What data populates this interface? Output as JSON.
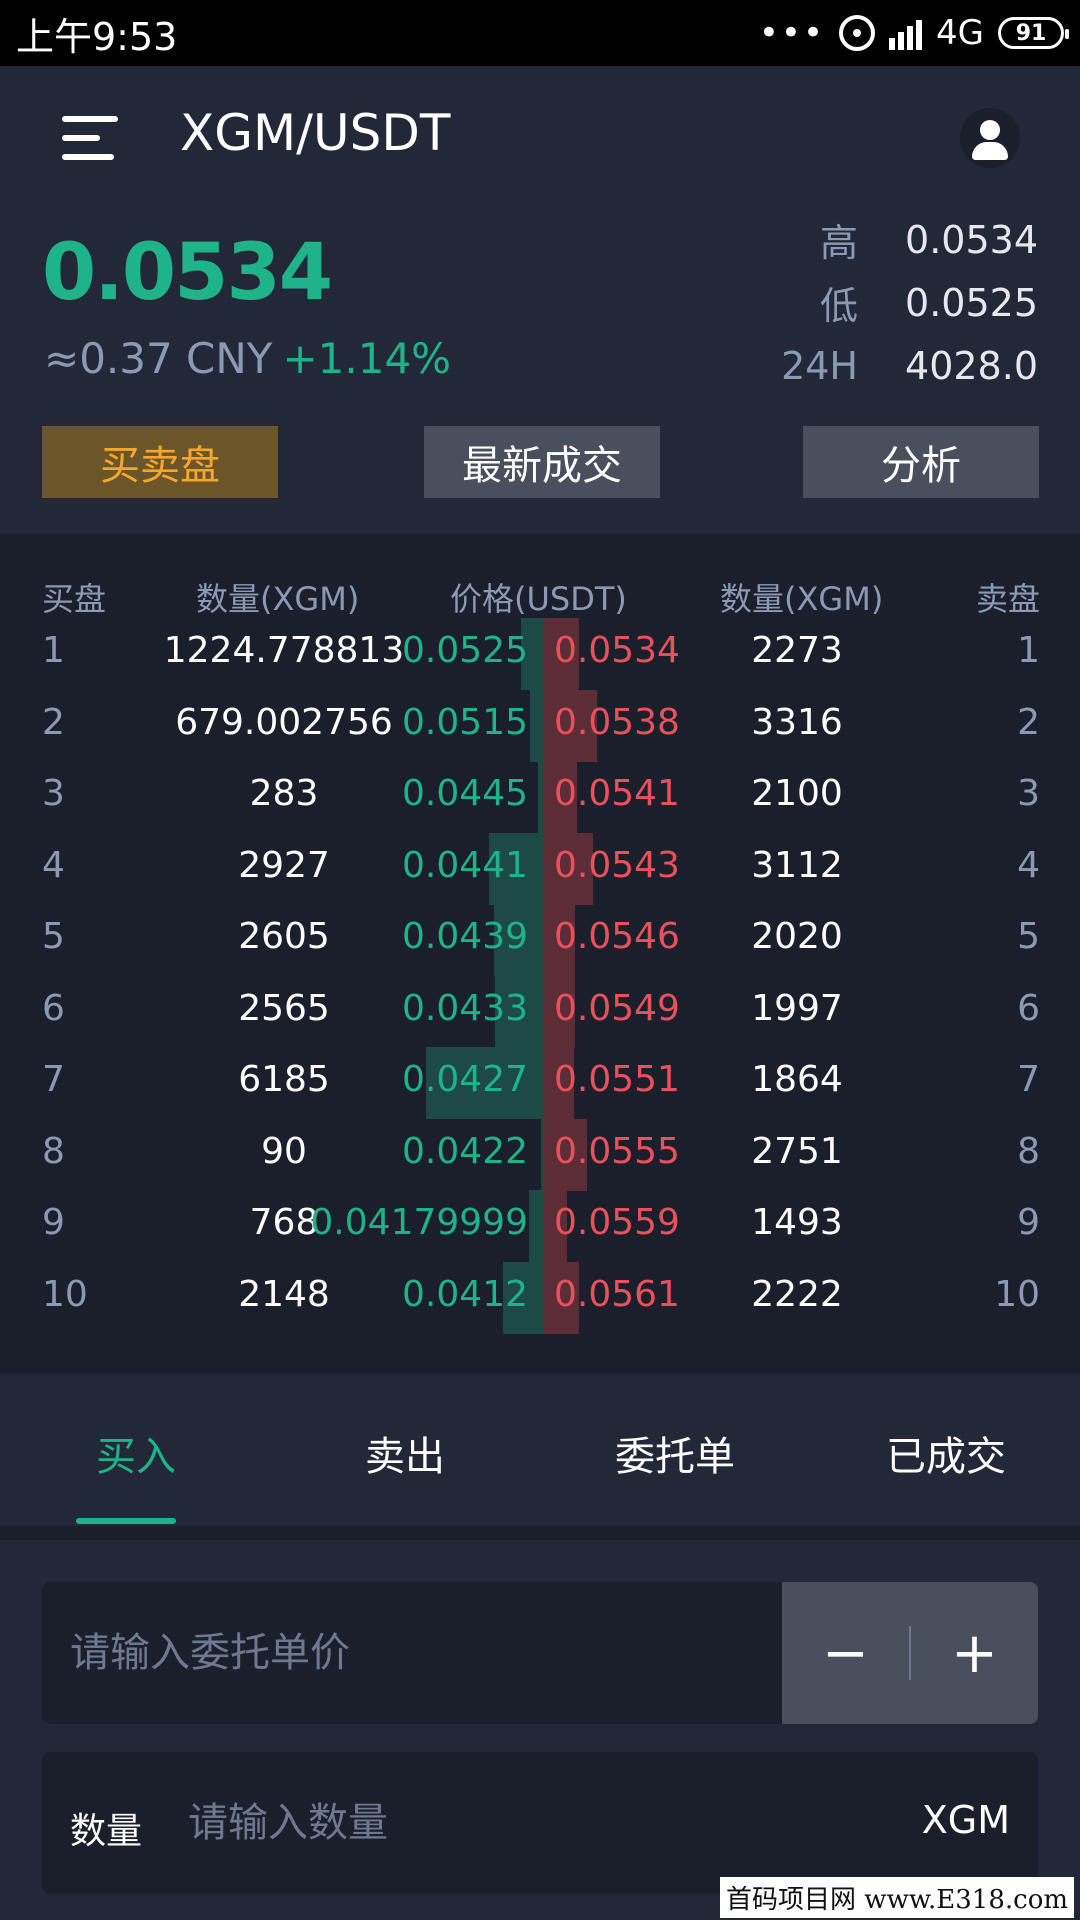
{
  "status_bar": {
    "time": "上午9:53",
    "dots": "•••",
    "network": "4G",
    "battery": "91"
  },
  "header": {
    "pair": "XGM/USDT"
  },
  "ticker": {
    "last_price": "0.0534",
    "cny": "≈0.37 CNY",
    "change": "+1.14%",
    "high_label": "高",
    "high": "0.0534",
    "low_label": "低",
    "low": "0.0525",
    "vol_label": "24H",
    "vol": "4028.0"
  },
  "segments": {
    "depth": "买卖盘",
    "latest": "最新成交",
    "analysis": "分析"
  },
  "orderbook": {
    "headers": {
      "bid": "买盘",
      "bid_qty": "数量(XGM)",
      "price": "价格(USDT)",
      "ask_qty": "数量(XGM)",
      "ask": "卖盘"
    },
    "rows": [
      {
        "idx": "1",
        "bid_qty": "1224.778813",
        "bid_price": "0.0525",
        "ask_price": "0.0534",
        "ask_qty": "2273",
        "bid_depth": 0.25,
        "ask_depth": 0.4
      },
      {
        "idx": "2",
        "bid_qty": "679.002756",
        "bid_price": "0.0515",
        "ask_price": "0.0538",
        "ask_qty": "3316",
        "bid_depth": 0.14,
        "ask_depth": 0.6
      },
      {
        "idx": "3",
        "bid_qty": "283",
        "bid_price": "0.0445",
        "ask_price": "0.0541",
        "ask_qty": "2100",
        "bid_depth": 0.06,
        "ask_depth": 0.38
      },
      {
        "idx": "4",
        "bid_qty": "2927",
        "bid_price": "0.0441",
        "ask_price": "0.0543",
        "ask_qty": "3112",
        "bid_depth": 0.6,
        "ask_depth": 0.56
      },
      {
        "idx": "5",
        "bid_qty": "2605",
        "bid_price": "0.0439",
        "ask_price": "0.0546",
        "ask_qty": "2020",
        "bid_depth": 0.54,
        "ask_depth": 0.36
      },
      {
        "idx": "6",
        "bid_qty": "2565",
        "bid_price": "0.0433",
        "ask_price": "0.0549",
        "ask_qty": "1997",
        "bid_depth": 0.53,
        "ask_depth": 0.36
      },
      {
        "idx": "7",
        "bid_qty": "6185",
        "bid_price": "0.0427",
        "ask_price": "0.0551",
        "ask_qty": "1864",
        "bid_depth": 1.3,
        "ask_depth": 0.34
      },
      {
        "idx": "8",
        "bid_qty": "90",
        "bid_price": "0.0422",
        "ask_price": "0.0555",
        "ask_qty": "2751",
        "bid_depth": 0.02,
        "ask_depth": 0.49
      },
      {
        "idx": "9",
        "bid_qty": "768",
        "bid_price": "0.04179999",
        "ask_price": "0.0559",
        "ask_qty": "1493",
        "bid_depth": 0.16,
        "ask_depth": 0.27
      },
      {
        "idx": "10",
        "bid_qty": "2148",
        "bid_price": "0.0412",
        "ask_price": "0.0561",
        "ask_qty": "2222",
        "bid_depth": 0.44,
        "ask_depth": 0.4
      }
    ]
  },
  "trade_tabs": {
    "buy": "买入",
    "sell": "卖出",
    "orders": "委托单",
    "filled": "已成交"
  },
  "form": {
    "price_placeholder": "请输入委托单价",
    "minus": "−",
    "plus": "+",
    "qty_label": "数量",
    "qty_placeholder": "请输入数量",
    "qty_unit": "XGM"
  },
  "watermark": "首码项目网 www.E318.com",
  "colors": {
    "up": "#1fb389",
    "down": "#e8505b",
    "accent": "#f5a62d"
  }
}
